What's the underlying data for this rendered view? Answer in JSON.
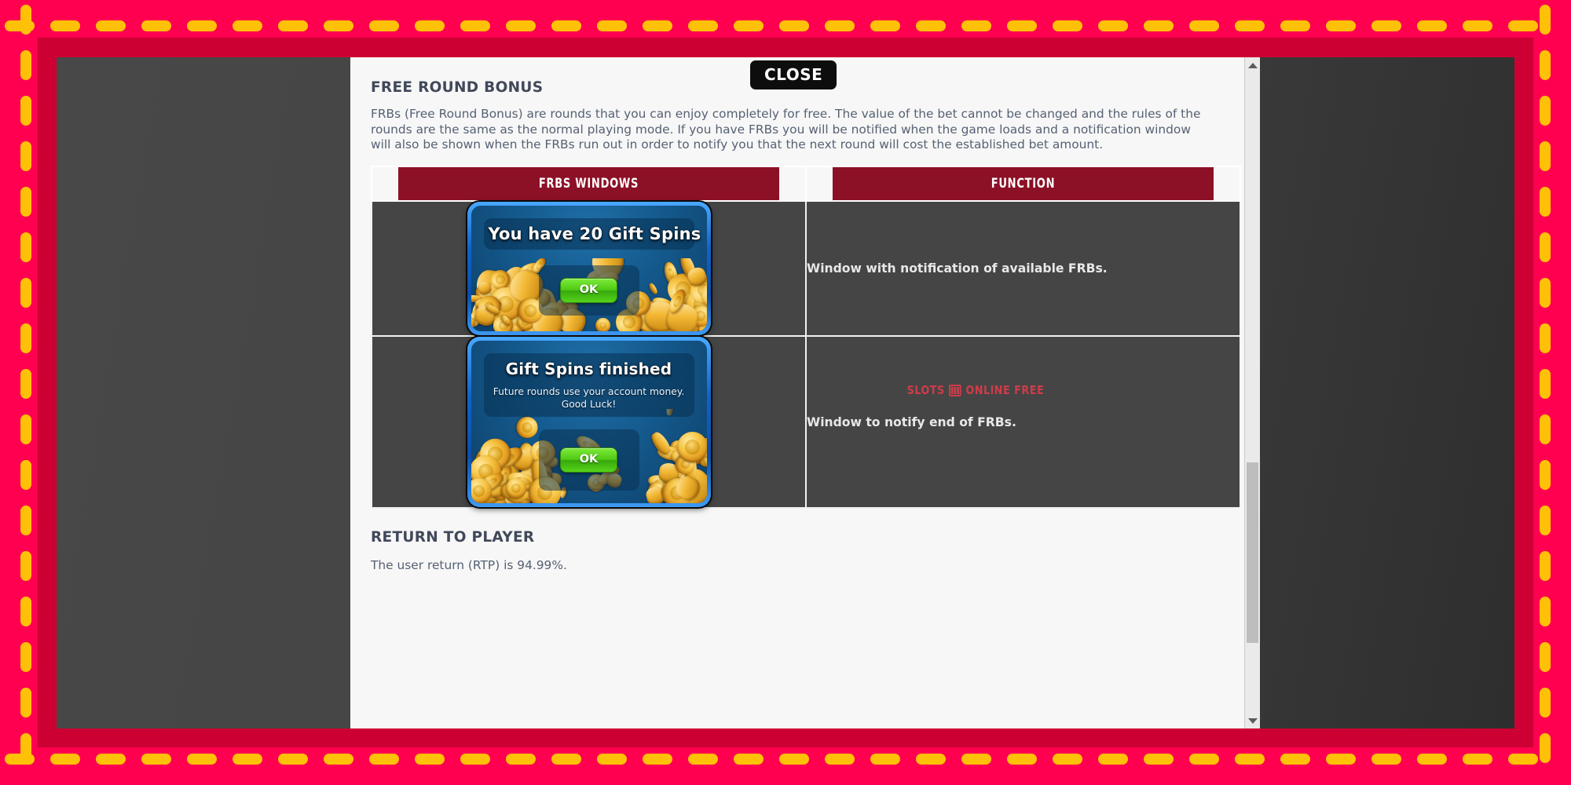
{
  "frame": {
    "background_color": "#ff0050",
    "dash_color": "#ffc107",
    "inner_band_color": "#cc0033"
  },
  "viewport": {
    "background_color": "#444444"
  },
  "toolbar": {
    "close_label": "CLOSE"
  },
  "panel": {
    "background_color": "#f7f7f7",
    "sections": {
      "free_round_bonus": {
        "title": "FREE ROUND BONUS",
        "paragraph": "FRBs (Free Round Bonus) are rounds that you can enjoy completely for free. The value of the bet cannot be changed and the rules of the rounds are the same as the normal playing mode. If you have FRBs you will be notified when the game loads and a notification window will also be shown when the FRBs run out in order to notify you that the next round will cost the established bet amount."
      },
      "return_to_player": {
        "title": "RETURN TO PLAYER",
        "paragraph": "The user return (RTP) is 94.99%."
      }
    },
    "table": {
      "header_color": "#8c1026",
      "columns": [
        "FRBS WINDOWS",
        "FUNCTION"
      ],
      "rows": [
        {
          "dialog": {
            "title": "You have 20 Gift Spins",
            "subtitle": "",
            "button_label": "OK"
          },
          "function": "Window with notification of available FRBs."
        },
        {
          "dialog": {
            "title": "Gift Spins finished",
            "subtitle": "Future rounds use your account money.\nGood Luck!",
            "button_label": "OK"
          },
          "function": "Window to notify end of FRBs."
        }
      ]
    }
  },
  "watermark": {
    "text_left": "SLOTS",
    "text_right": "ONLINE FREE",
    "icon": "slot-machine-icon",
    "color": "#e23b4a"
  },
  "scrollbar": {
    "up_arrow": "chevron-up-icon",
    "down_arrow": "chevron-down-icon",
    "thumb": "scrollbar-thumb"
  }
}
